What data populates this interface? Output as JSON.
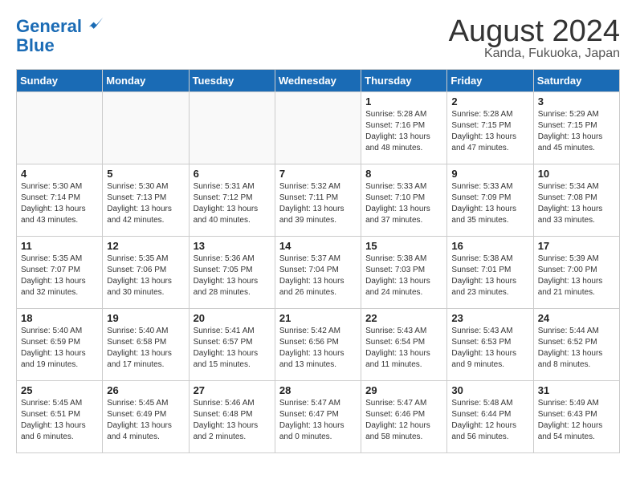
{
  "logo": {
    "line1": "General",
    "line2": "Blue"
  },
  "title": "August 2024",
  "location": "Kanda, Fukuoka, Japan",
  "weekdays": [
    "Sunday",
    "Monday",
    "Tuesday",
    "Wednesday",
    "Thursday",
    "Friday",
    "Saturday"
  ],
  "weeks": [
    [
      {
        "day": "",
        "info": ""
      },
      {
        "day": "",
        "info": ""
      },
      {
        "day": "",
        "info": ""
      },
      {
        "day": "",
        "info": ""
      },
      {
        "day": "1",
        "info": "Sunrise: 5:28 AM\nSunset: 7:16 PM\nDaylight: 13 hours\nand 48 minutes."
      },
      {
        "day": "2",
        "info": "Sunrise: 5:28 AM\nSunset: 7:15 PM\nDaylight: 13 hours\nand 47 minutes."
      },
      {
        "day": "3",
        "info": "Sunrise: 5:29 AM\nSunset: 7:15 PM\nDaylight: 13 hours\nand 45 minutes."
      }
    ],
    [
      {
        "day": "4",
        "info": "Sunrise: 5:30 AM\nSunset: 7:14 PM\nDaylight: 13 hours\nand 43 minutes."
      },
      {
        "day": "5",
        "info": "Sunrise: 5:30 AM\nSunset: 7:13 PM\nDaylight: 13 hours\nand 42 minutes."
      },
      {
        "day": "6",
        "info": "Sunrise: 5:31 AM\nSunset: 7:12 PM\nDaylight: 13 hours\nand 40 minutes."
      },
      {
        "day": "7",
        "info": "Sunrise: 5:32 AM\nSunset: 7:11 PM\nDaylight: 13 hours\nand 39 minutes."
      },
      {
        "day": "8",
        "info": "Sunrise: 5:33 AM\nSunset: 7:10 PM\nDaylight: 13 hours\nand 37 minutes."
      },
      {
        "day": "9",
        "info": "Sunrise: 5:33 AM\nSunset: 7:09 PM\nDaylight: 13 hours\nand 35 minutes."
      },
      {
        "day": "10",
        "info": "Sunrise: 5:34 AM\nSunset: 7:08 PM\nDaylight: 13 hours\nand 33 minutes."
      }
    ],
    [
      {
        "day": "11",
        "info": "Sunrise: 5:35 AM\nSunset: 7:07 PM\nDaylight: 13 hours\nand 32 minutes."
      },
      {
        "day": "12",
        "info": "Sunrise: 5:35 AM\nSunset: 7:06 PM\nDaylight: 13 hours\nand 30 minutes."
      },
      {
        "day": "13",
        "info": "Sunrise: 5:36 AM\nSunset: 7:05 PM\nDaylight: 13 hours\nand 28 minutes."
      },
      {
        "day": "14",
        "info": "Sunrise: 5:37 AM\nSunset: 7:04 PM\nDaylight: 13 hours\nand 26 minutes."
      },
      {
        "day": "15",
        "info": "Sunrise: 5:38 AM\nSunset: 7:03 PM\nDaylight: 13 hours\nand 24 minutes."
      },
      {
        "day": "16",
        "info": "Sunrise: 5:38 AM\nSunset: 7:01 PM\nDaylight: 13 hours\nand 23 minutes."
      },
      {
        "day": "17",
        "info": "Sunrise: 5:39 AM\nSunset: 7:00 PM\nDaylight: 13 hours\nand 21 minutes."
      }
    ],
    [
      {
        "day": "18",
        "info": "Sunrise: 5:40 AM\nSunset: 6:59 PM\nDaylight: 13 hours\nand 19 minutes."
      },
      {
        "day": "19",
        "info": "Sunrise: 5:40 AM\nSunset: 6:58 PM\nDaylight: 13 hours\nand 17 minutes."
      },
      {
        "day": "20",
        "info": "Sunrise: 5:41 AM\nSunset: 6:57 PM\nDaylight: 13 hours\nand 15 minutes."
      },
      {
        "day": "21",
        "info": "Sunrise: 5:42 AM\nSunset: 6:56 PM\nDaylight: 13 hours\nand 13 minutes."
      },
      {
        "day": "22",
        "info": "Sunrise: 5:43 AM\nSunset: 6:54 PM\nDaylight: 13 hours\nand 11 minutes."
      },
      {
        "day": "23",
        "info": "Sunrise: 5:43 AM\nSunset: 6:53 PM\nDaylight: 13 hours\nand 9 minutes."
      },
      {
        "day": "24",
        "info": "Sunrise: 5:44 AM\nSunset: 6:52 PM\nDaylight: 13 hours\nand 8 minutes."
      }
    ],
    [
      {
        "day": "25",
        "info": "Sunrise: 5:45 AM\nSunset: 6:51 PM\nDaylight: 13 hours\nand 6 minutes."
      },
      {
        "day": "26",
        "info": "Sunrise: 5:45 AM\nSunset: 6:49 PM\nDaylight: 13 hours\nand 4 minutes."
      },
      {
        "day": "27",
        "info": "Sunrise: 5:46 AM\nSunset: 6:48 PM\nDaylight: 13 hours\nand 2 minutes."
      },
      {
        "day": "28",
        "info": "Sunrise: 5:47 AM\nSunset: 6:47 PM\nDaylight: 13 hours\nand 0 minutes."
      },
      {
        "day": "29",
        "info": "Sunrise: 5:47 AM\nSunset: 6:46 PM\nDaylight: 12 hours\nand 58 minutes."
      },
      {
        "day": "30",
        "info": "Sunrise: 5:48 AM\nSunset: 6:44 PM\nDaylight: 12 hours\nand 56 minutes."
      },
      {
        "day": "31",
        "info": "Sunrise: 5:49 AM\nSunset: 6:43 PM\nDaylight: 12 hours\nand 54 minutes."
      }
    ]
  ]
}
